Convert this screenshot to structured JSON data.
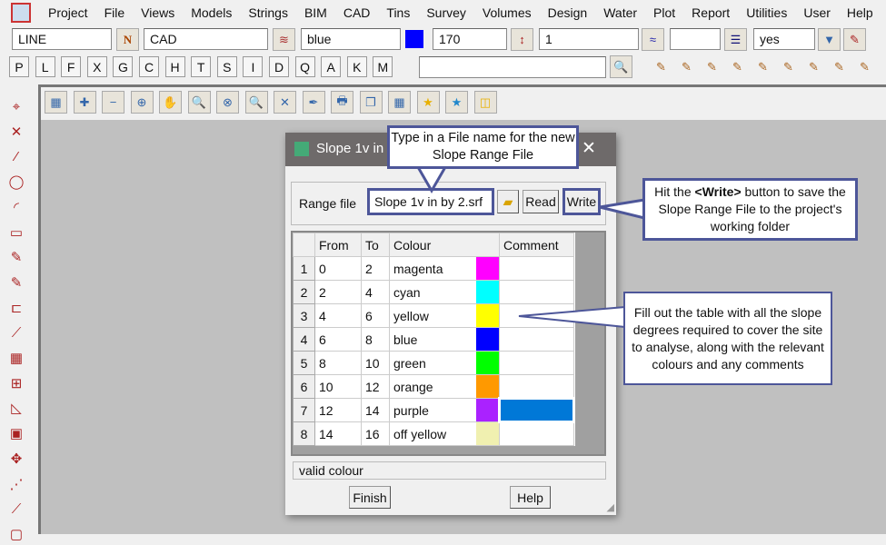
{
  "menu": [
    "Project",
    "File",
    "Views",
    "Models",
    "Strings",
    "BIM",
    "CAD",
    "Tins",
    "Survey",
    "Volumes",
    "Design",
    "Water",
    "Plot",
    "Report",
    "Utilities",
    "User",
    "Help"
  ],
  "toolbar": {
    "name": "LINE",
    "model": "CAD",
    "colour": "blue",
    "colour_hex": "#0000ff",
    "weight": "170",
    "z": "1",
    "style": "",
    "flag": "yes"
  },
  "letter_buttons": [
    "P",
    "L",
    "F",
    "X",
    "G",
    "C",
    "H",
    "T",
    "S",
    "I",
    "D",
    "Q",
    "A",
    "K",
    "M"
  ],
  "search": {
    "value": ""
  },
  "dialog": {
    "title": "Slope 1v in",
    "range_file_label": "Range file",
    "range_file_value": "Slope 1v in by 2.srf",
    "read_label": "Read",
    "write_label": "Write",
    "columns": [
      "From",
      "To",
      "Colour",
      "Comment"
    ],
    "rows": [
      {
        "n": "1",
        "from": "0",
        "to": "2",
        "colour": "magenta",
        "hex": "#ff00ff",
        "comment": ""
      },
      {
        "n": "2",
        "from": "2",
        "to": "4",
        "colour": "cyan",
        "hex": "#00ffff",
        "comment": ""
      },
      {
        "n": "3",
        "from": "4",
        "to": "6",
        "colour": "yellow",
        "hex": "#ffff00",
        "comment": ""
      },
      {
        "n": "4",
        "from": "6",
        "to": "8",
        "colour": "blue",
        "hex": "#0000ff",
        "comment": ""
      },
      {
        "n": "5",
        "from": "8",
        "to": "10",
        "colour": "green",
        "hex": "#00ff00",
        "comment": ""
      },
      {
        "n": "6",
        "from": "10",
        "to": "12",
        "colour": "orange",
        "hex": "#ff9900",
        "comment": ""
      },
      {
        "n": "7",
        "from": "12",
        "to": "14",
        "colour": "purple",
        "hex": "#aa22ff",
        "comment": ""
      },
      {
        "n": "8",
        "from": "14",
        "to": "16",
        "colour": "off yellow",
        "hex": "#f0f0b0",
        "comment": ""
      }
    ],
    "status": "valid colour",
    "finish_label": "Finish",
    "help_label": "Help"
  },
  "callouts": {
    "filename": "Type in a File name for the new Slope Range File",
    "write_pre": "Hit the ",
    "write_bold": "<Write>",
    "write_post": " button to save the Slope Range File to the project's working folder",
    "table": "Fill out the table with all the slope degrees required to cover the site to analyse, along with the relevant colours and any comments"
  }
}
